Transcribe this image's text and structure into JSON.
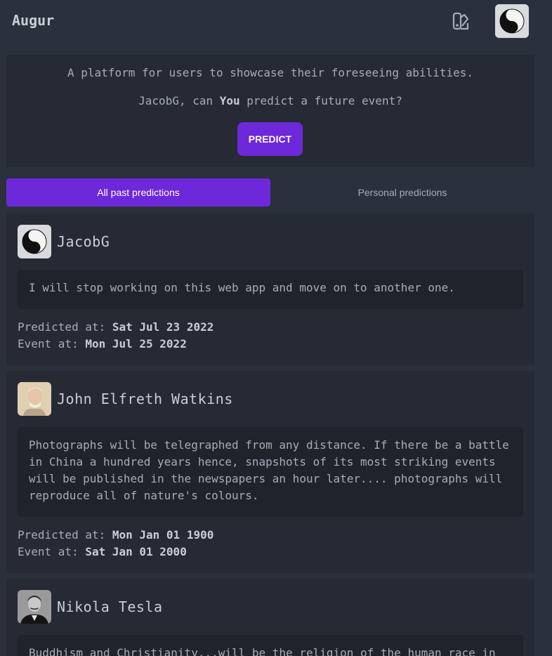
{
  "navbar": {
    "brand": "Augur",
    "theme_icon": "theme-swatch-icon",
    "avatar_icon": "yin-yang-icon"
  },
  "hero": {
    "tagline": "A platform for users to showcase their foreseeing abilities.",
    "question_prefix": "JacobG, can ",
    "question_bold": "You",
    "question_suffix": " predict a future event?",
    "predict_label": "PREDICT"
  },
  "tabs": {
    "all": "All past predictions",
    "personal": "Personal predictions"
  },
  "labels": {
    "predicted_at": "Predicted at: ",
    "event_at": "Event at: "
  },
  "predictions": [
    {
      "name": "JacobG",
      "avatar": "yin-yang-avatar",
      "text": "I will stop working on this web app and move on to another one.",
      "predicted_at": "Sat Jul 23 2022",
      "event_at": "Mon Jul 25 2022"
    },
    {
      "name": "John Elfreth Watkins",
      "avatar": "portrait-avatar",
      "text": "Photographs will be telegraphed from any distance. If there be a battle in China a hundred years hence, snapshots of its most striking events will be published in the newspapers an hour later.... photographs will reproduce all of nature's colours.",
      "predicted_at": "Mon Jan 01 1900",
      "event_at": "Sat Jan 01 2000"
    },
    {
      "name": "Nikola Tesla",
      "avatar": "portrait-avatar",
      "text": "Buddhism and Christianity...will be the religion of the human race in"
    }
  ],
  "colors": {
    "background": "#2a303c",
    "card": "#252a35",
    "body_box": "#1f232c",
    "accent": "#6d28d9"
  }
}
